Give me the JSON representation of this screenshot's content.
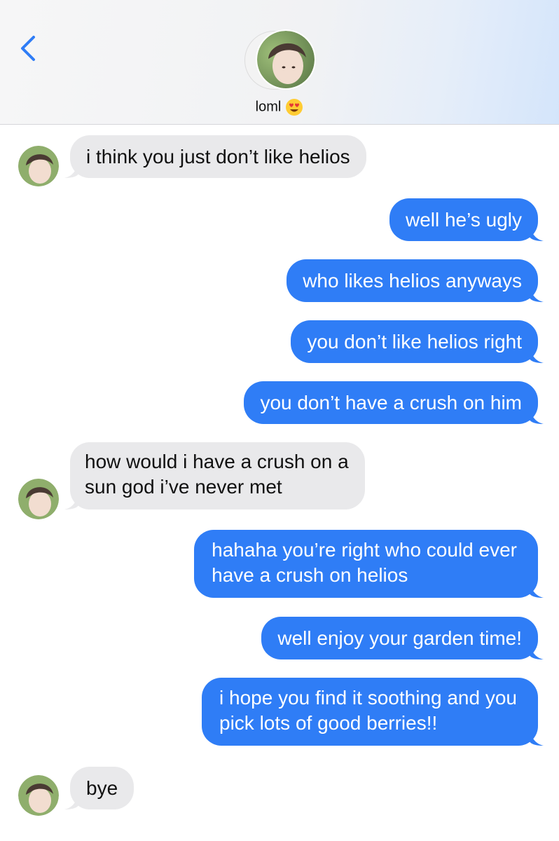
{
  "header": {
    "contact_name": "loml",
    "contact_emoji": "heart-eyes-emoji",
    "back_icon": "chevron-left-icon",
    "accent": "#2f7df6"
  },
  "messages": [
    {
      "direction": "incoming",
      "lines": [
        "i think you just don’t like helios"
      ]
    },
    {
      "direction": "outgoing",
      "lines": [
        "well he’s ugly"
      ]
    },
    {
      "direction": "outgoing",
      "lines": [
        "who likes helios anyways"
      ]
    },
    {
      "direction": "outgoing",
      "lines": [
        "you don’t like helios right"
      ]
    },
    {
      "direction": "outgoing",
      "lines": [
        "you don’t have a crush on him"
      ]
    },
    {
      "direction": "incoming",
      "lines": [
        "how would i have a crush on a",
        "sun god i’ve never met"
      ]
    },
    {
      "direction": "outgoing",
      "lines": [
        "hahaha you’re right who could ever",
        "have a crush on helios"
      ]
    },
    {
      "direction": "outgoing",
      "lines": [
        "well enjoy your garden time!"
      ]
    },
    {
      "direction": "outgoing",
      "lines": [
        "i hope you find it soothing and you",
        "pick lots of good berries!!"
      ]
    },
    {
      "direction": "incoming",
      "lines": [
        "bye"
      ]
    }
  ],
  "colors": {
    "outgoing_bubble": "#2f7df6",
    "incoming_bubble": "#e9e9eb"
  }
}
